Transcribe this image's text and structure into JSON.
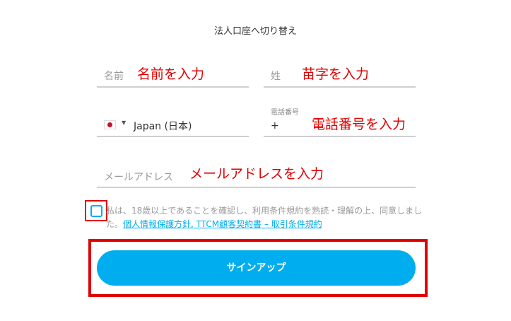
{
  "header": {
    "switch_link": "法人口座へ切り替え"
  },
  "form": {
    "first_name": {
      "placeholder": "名前",
      "annotation": "名前を入力"
    },
    "last_name": {
      "placeholder": "姓",
      "annotation": "苗字を入力"
    },
    "country": {
      "value": "Japan (日本)",
      "flag_icon": "japan-flag-icon"
    },
    "phone": {
      "label": "電話番号",
      "prefix": "+",
      "annotation": "電話番号を入力"
    },
    "email": {
      "placeholder": "メールアドレス",
      "annotation": "メールアドレスを入力"
    }
  },
  "consent": {
    "line1": "私は、18歳以上であることを確認し、利用条件規約を熟読・理解の上、同意しまし",
    "line2_prefix": "た。",
    "links": "個人情報保護方針, TTCM顧客契約書 – 取引条件規約"
  },
  "signup": {
    "label": "サインアップ"
  },
  "colors": {
    "accent": "#00aeef",
    "annotation": "#e00000"
  }
}
